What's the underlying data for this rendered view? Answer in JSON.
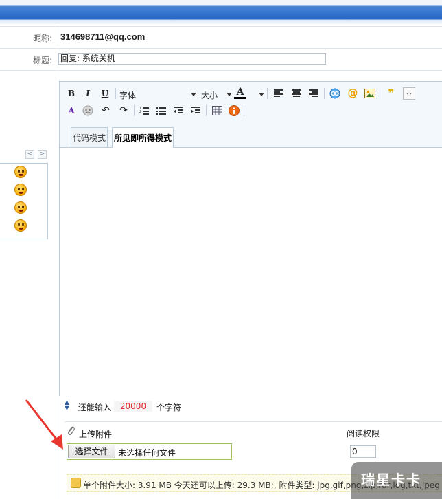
{
  "form": {
    "nickname_label": "昵称:",
    "nickname_value": "314698711@qq.com",
    "subject_label": "标题:",
    "subject_value": "回复: 系统关机"
  },
  "editor": {
    "toolbar": {
      "bold": "B",
      "italic": "I",
      "underline": "U",
      "font_select": "字体",
      "size_select": "大小",
      "font_color": "A"
    },
    "tabs": [
      {
        "label": "代码模式"
      },
      {
        "label": "所见即所得模式"
      }
    ],
    "active_tab": "所见即所得模式",
    "content": ""
  },
  "smileys": {
    "prev": "<",
    "next": ">",
    "faces": [
      "smiley-shy",
      "smiley-cry",
      "smiley-grin",
      "smiley-shock"
    ]
  },
  "char_count": {
    "prefix": "还能输入",
    "remaining": "20000",
    "suffix": "个字符"
  },
  "attachment": {
    "label": "上传附件",
    "choose_button": "选择文件",
    "no_file_text": "未选择任何文件",
    "permission_label": "阅读权限",
    "permission_value": "0",
    "info": "单个附件大小: 3.91 MB  今天还可以上传: 29.3 MB;,  附件类型: jpg,gif,png,zip,rar,log,txt,jpeg"
  },
  "watermark": "瑞星卡卡",
  "colors": {
    "header_blue": "#2f6fcd",
    "remaining_red": "#e0262b",
    "file_box_border": "#9cc45a",
    "arrow_red": "#e8372e"
  }
}
